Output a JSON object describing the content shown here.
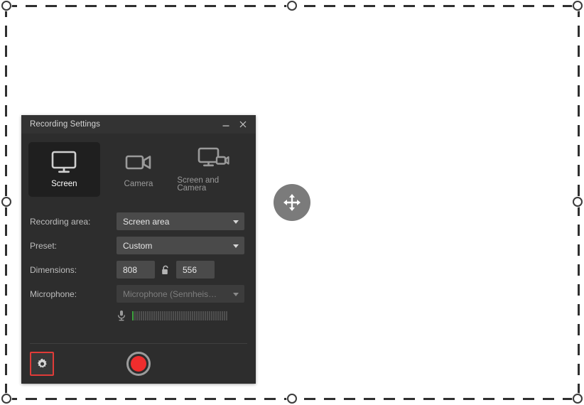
{
  "selection": {
    "name": "screen-capture-selection",
    "border_color": "#2f2f2f",
    "handle_color": "#ffffff",
    "move_handle_color": "#7b7b7b",
    "move_handle_icon": "move-arrows-icon"
  },
  "panel": {
    "title": "Recording Settings",
    "minimize_label": "–",
    "close_label": "✕",
    "background": "#2d2d2d",
    "modes": [
      {
        "label": "Screen",
        "icon": "monitor-icon",
        "selected": true
      },
      {
        "label": "Camera",
        "icon": "camcorder-icon",
        "selected": false
      },
      {
        "label": "Screen and Camera",
        "icon": "monitor-and-camcorder-icon",
        "selected": false
      }
    ],
    "fields": {
      "recording_area": {
        "label": "Recording area:",
        "value": "Screen area",
        "disabled": false
      },
      "preset": {
        "label": "Preset:",
        "value": "Custom",
        "disabled": false
      },
      "dimensions": {
        "label": "Dimensions:",
        "width": "808",
        "height": "556",
        "lock_icon": "unlocked-padlock-icon"
      },
      "microphone": {
        "label": "Microphone:",
        "value": "Microphone (Sennheis…",
        "disabled": true,
        "meter_icon": "microphone-icon",
        "meter_total_bars": 45,
        "meter_active_bars": 1,
        "meter_active_color": "#3ea33e",
        "meter_inactive_color": "#4e4e4e"
      }
    },
    "footer": {
      "settings_label": "⚙",
      "settings_icon": "gear-icon",
      "settings_highlight_color": "#e03b38",
      "record_icon": "record-button-icon",
      "record_color": "#ef2d2d"
    }
  }
}
